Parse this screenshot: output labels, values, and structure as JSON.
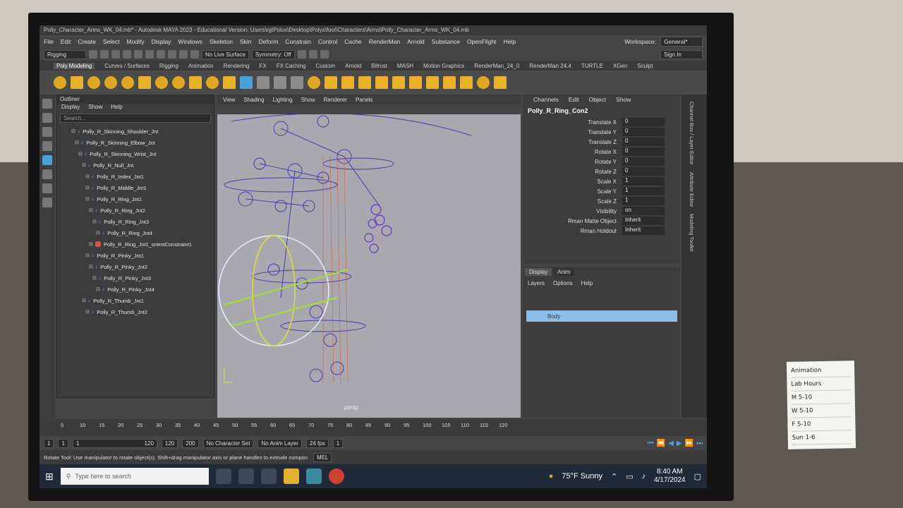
{
  "window": {
    "title": "Polly_Character_Arms_WK_04.mb* - Autodesk MAYA 2023 - Educational Version: Users\\rgtPolus\\Desktop\\Polys\\foot\\Characters\\Arms\\Polly_Character_Arms_WK_04.mb",
    "selected_object": "Polly_R_Ring_Con2",
    "workspace_label": "Workspace:",
    "workspace_value": "General*"
  },
  "menubar": [
    "File",
    "Edit",
    "Create",
    "Select",
    "Modify",
    "Display",
    "Windows",
    "Skeleton",
    "Skin",
    "Deform",
    "Constrain",
    "Control",
    "Cache",
    "RenderMan",
    "Arnold",
    "Substance",
    "OpenFlight",
    "Help"
  ],
  "status": {
    "mode": "Rigging",
    "live_surface": "No Live Surface",
    "symmetry": "Symmetry: Off",
    "sign_in": "Sign In"
  },
  "shelf_tabs": [
    "Poly Modeling",
    "Curves / Surfaces",
    "Rigging",
    "Animation",
    "Rendering",
    "FX",
    "FX Caching",
    "Custom",
    "Arnold",
    "Bifrost",
    "MASH",
    "Motion Graphics",
    "RenderMan_24_0",
    "RenderMan 24.4",
    "TURTLE",
    "XGen",
    "Sculpt"
  ],
  "outliner": {
    "title": "Outliner",
    "menu": [
      "Display",
      "Show",
      "Help"
    ],
    "search_placeholder": "Search...",
    "items": [
      {
        "label": "Polly_R_Skinning_Shoulder_Jnt",
        "indent": 40
      },
      {
        "label": "Polly_R_Skinning_Elbow_Jnt",
        "indent": 50
      },
      {
        "label": "Polly_R_Skinning_Wrist_Jnt",
        "indent": 60
      },
      {
        "label": "Polly_R_Null_Jnt",
        "indent": 70
      },
      {
        "label": "Polly_R_Index_Jnt1",
        "indent": 80
      },
      {
        "label": "Polly_R_Middle_Jnt1",
        "indent": 80
      },
      {
        "label": "Polly_R_Ring_Jnt1",
        "indent": 80
      },
      {
        "label": "Polly_R_Ring_Jnt2",
        "indent": 90
      },
      {
        "label": "Polly_R_Ring_Jnt3",
        "indent": 100
      },
      {
        "label": "Polly_R_Ring_Jnt4",
        "indent": 110
      },
      {
        "label": "Polly_R_Ring_Jnt1_orientConstraint1",
        "indent": 90,
        "constraint": true
      },
      {
        "label": "Polly_R_Pinky_Jnt1",
        "indent": 80
      },
      {
        "label": "Polly_R_Pinky_Jnt2",
        "indent": 90
      },
      {
        "label": "Polly_R_Pinky_Jnt3",
        "indent": 100
      },
      {
        "label": "Polly_R_Pinky_Jnt4",
        "indent": 110
      },
      {
        "label": "Polly_R_Thumb_Jnt1",
        "indent": 70
      },
      {
        "label": "Polly_R_Thumb_Jnt2",
        "indent": 80
      }
    ]
  },
  "viewport": {
    "menu": [
      "View",
      "Shading",
      "Lighting",
      "Show",
      "Renderer",
      "Panels"
    ],
    "camera_label": "persp"
  },
  "channel_box": {
    "menu": [
      "Channels",
      "Edit",
      "Object",
      "Show"
    ],
    "object": "Polly_R_Ring_Con2",
    "channels": [
      {
        "name": "Translate X",
        "value": "0"
      },
      {
        "name": "Translate Y",
        "value": "0"
      },
      {
        "name": "Translate Z",
        "value": "0"
      },
      {
        "name": "Rotate X",
        "value": "0"
      },
      {
        "name": "Rotate Y",
        "value": "0"
      },
      {
        "name": "Rotate Z",
        "value": "0"
      },
      {
        "name": "Scale X",
        "value": "1"
      },
      {
        "name": "Scale Y",
        "value": "1"
      },
      {
        "name": "Scale Z",
        "value": "1"
      },
      {
        "name": "Visibility",
        "value": "on"
      },
      {
        "name": "Rman Matte Object",
        "value": "Inherit"
      },
      {
        "name": "Rman Holdout",
        "value": "Inherit"
      }
    ]
  },
  "layer_editor": {
    "tabs": [
      "Display",
      "Anim"
    ],
    "menu": [
      "Layers",
      "Options",
      "Help"
    ],
    "layer_name": "Body"
  },
  "side_tabs": [
    "Channel Box / Layer Editor",
    "Attribute Editor",
    "Modeling Toolkit"
  ],
  "timeline": {
    "ticks": [
      "5",
      "10",
      "15",
      "20",
      "25",
      "30",
      "35",
      "40",
      "45",
      "50",
      "55",
      "60",
      "65",
      "70",
      "75",
      "80",
      "85",
      "90",
      "95",
      "100",
      "105",
      "110",
      "115",
      "120"
    ],
    "current_frame": "1"
  },
  "range": {
    "start": "1",
    "playback_start": "1",
    "slider_start": "1",
    "slider_end": "120",
    "playback_end": "120",
    "end": "200",
    "character_set": "No Character Set",
    "anim_layer": "No Anim Layer",
    "fps": "24 fps"
  },
  "cmdline": {
    "help": "Rotate Tool: Use manipulator to rotate object(s). Shift+drag manipulator axis or plane handles to extrude compon",
    "lang": "MEL"
  },
  "taskbar": {
    "search_placeholder": "Type here to search",
    "weather": "75°F  Sunny",
    "time": "8:40 AM",
    "date": "4/17/2024"
  },
  "sticky_note": {
    "lines": [
      "Animation",
      "Lab Hours",
      "M   5-10",
      "W   5-10",
      "F   5-10",
      "Sun  1-6"
    ]
  }
}
